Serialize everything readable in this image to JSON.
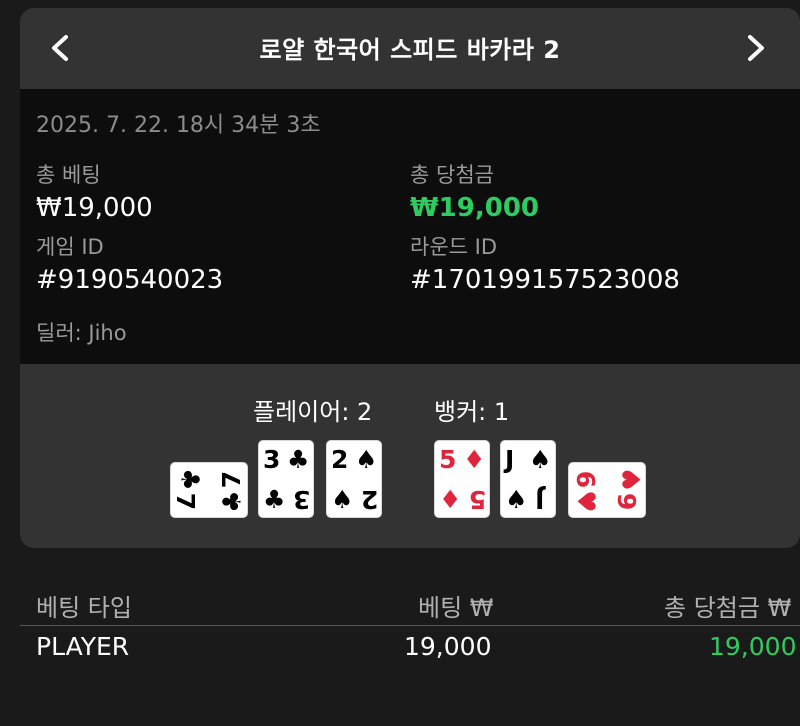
{
  "header": {
    "title": "로얄 한국어 스피드 바카라 2"
  },
  "info": {
    "timestamp": "2025. 7. 22. 18시 34분 3초",
    "total_bet_label": "총 베팅",
    "total_bet_value": "₩19,000",
    "total_win_label": "총 당첨금",
    "total_win_value": "₩19,000",
    "game_id_label": "게임 ID",
    "game_id_value": "#9190540023",
    "round_id_label": "라운드 ID",
    "round_id_value": "#170199157523008",
    "dealer": "딜러: Jiho"
  },
  "hands": {
    "player": {
      "label": "플레이어: 2",
      "cards": [
        {
          "rank": "7",
          "suit": "♣",
          "color": "black",
          "orientation": "sideways"
        },
        {
          "rank": "3",
          "suit": "♣",
          "color": "black",
          "orientation": "upright"
        },
        {
          "rank": "2",
          "suit": "♠",
          "color": "black",
          "orientation": "upright"
        }
      ]
    },
    "banker": {
      "label": "뱅커: 1",
      "cards": [
        {
          "rank": "5",
          "suit": "♦",
          "color": "red",
          "orientation": "upright"
        },
        {
          "rank": "J",
          "suit": "♠",
          "color": "black",
          "orientation": "upright"
        },
        {
          "rank": "6",
          "suit": "♥",
          "color": "red",
          "orientation": "sideways"
        }
      ]
    }
  },
  "table": {
    "headers": {
      "bet_type": "베팅 타입",
      "bet": "베팅 ₩",
      "total_win": "총 당첨금 ₩"
    },
    "rows": [
      {
        "bet_type": "PLAYER",
        "bet": "19,000",
        "total_win": "19,000"
      }
    ]
  },
  "colors": {
    "win_green": "#2ecc60",
    "card_red": "#e0243c",
    "panel": "#333333",
    "info_bg": "#0d0d0d"
  },
  "icons": {
    "prev": "chevron-left-icon",
    "next": "chevron-right-icon"
  }
}
